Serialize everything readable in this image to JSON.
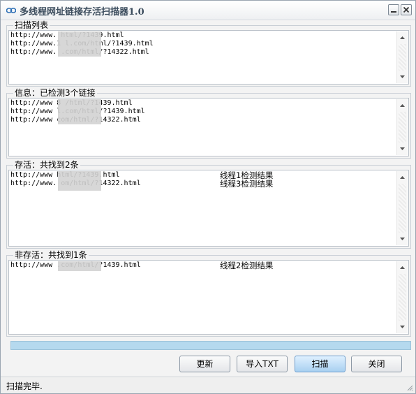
{
  "window": {
    "title": "多线程网址链接存活扫描器1.0"
  },
  "groups": {
    "scan_list": {
      "label": "扫描列表",
      "lines": [
        {
          "url": "http://www.          html/?1439.html"
        },
        {
          "url": "http://www.1       l.com/html/?1439.html"
        },
        {
          "url": "http://www.        .com/html/?14322.html"
        }
      ]
    },
    "info": {
      "label": "信息：已检测3个链接",
      "lines": [
        {
          "url": "http://www  8      /html/?1439.html"
        },
        {
          "url": "http://www         l.com/html/?1439.html"
        },
        {
          "url": "http://www         com/html/?14322.html"
        }
      ]
    },
    "alive": {
      "label": "存活：共找到2条",
      "lines": [
        {
          "url": "http://www         html/?1439.html",
          "result": "线程1检测结果"
        },
        {
          "url": "http://www.        om/html/?14322.html",
          "result": "线程3检测结果"
        }
      ]
    },
    "dead": {
      "label": "非存活：共找到1条",
      "lines": [
        {
          "url": "http://www         .com/html/?1439.html",
          "result": "线程2检测结果"
        }
      ]
    }
  },
  "progress": {
    "value": 1.0
  },
  "buttons": {
    "refresh": "更新",
    "import_txt": "导入TXT",
    "scan": "扫描",
    "close": "关闭"
  },
  "status": {
    "text": "扫描完毕."
  },
  "colors": {
    "progress_fill": "#b5d9ee",
    "primary_button": "#a8d0f0"
  }
}
